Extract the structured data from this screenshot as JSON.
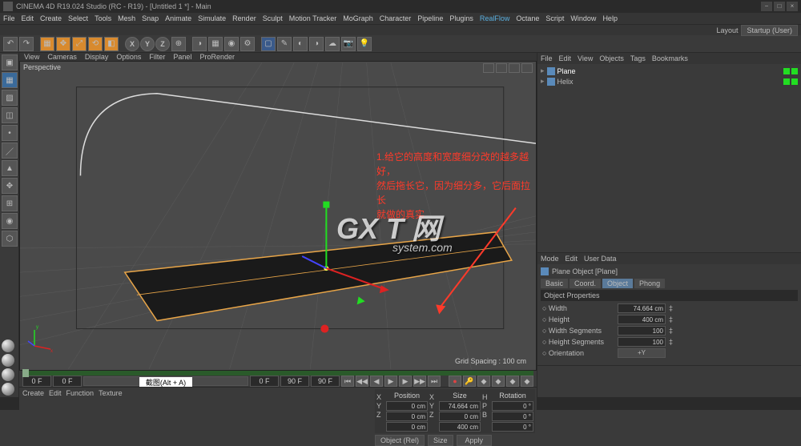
{
  "titlebar": {
    "title": "CINEMA 4D R19.024 Studio (RC - R19) - [Untitled 1 *] - Main"
  },
  "menubar": {
    "items": [
      "File",
      "Edit",
      "Create",
      "Select",
      "Tools",
      "Mesh",
      "Snap",
      "Animate",
      "Simulate",
      "Render",
      "Sculpt",
      "Motion Tracker",
      "MoGraph",
      "Character",
      "Pipeline",
      "Plugins",
      "RealFlow",
      "Octane",
      "Script",
      "Window",
      "Help"
    ]
  },
  "layout": {
    "label": "Layout",
    "value": "Startup (User)"
  },
  "toolbar_xyz": [
    "X",
    "Y",
    "Z"
  ],
  "viewport_menu": {
    "items": [
      "View",
      "Cameras",
      "Display",
      "Options",
      "Filter",
      "Panel",
      "ProRender"
    ]
  },
  "viewport": {
    "label": "Perspective",
    "grid_spacing": "Grid Spacing : 100 cm"
  },
  "annotation": {
    "line1": "1.给它的高度和宽度细分改的越多越好，",
    "line2": "然后拖长它，因为细分多，它后面拉长",
    "line3": "就做的真实"
  },
  "watermark": {
    "main": "GX T 网",
    "sub": "system.com"
  },
  "timeline": {
    "frame_start_a": "0 F",
    "frame_start_b": "0 F",
    "hint": "截图(Alt + A)",
    "frame_cur": "0 F",
    "frame_end_a": "90 F",
    "frame_end_b": "90 F"
  },
  "coord_panel": {
    "tabs": [
      "Create",
      "Edit",
      "Function",
      "Texture"
    ],
    "headers": [
      "Position",
      "Size",
      "Rotation"
    ],
    "rows": [
      {
        "axis": "X",
        "pos": "0 cm",
        "slbl": "X",
        "size": "74.664 cm",
        "rlbl": "H",
        "rot": "0 °"
      },
      {
        "axis": "Y",
        "pos": "0 cm",
        "slbl": "Y",
        "size": "0 cm",
        "rlbl": "P",
        "rot": "0 °"
      },
      {
        "axis": "Z",
        "pos": "0 cm",
        "slbl": "Z",
        "size": "400 cm",
        "rlbl": "B",
        "rot": "0 °"
      }
    ],
    "mode_drop": "Object (Rel)",
    "size_drop": "Size",
    "apply": "Apply"
  },
  "right_panel": {
    "menu": [
      "File",
      "Edit",
      "View",
      "Objects",
      "Tags",
      "Bookmarks"
    ],
    "tree": [
      {
        "name": "Plane",
        "selected": true
      },
      {
        "name": "Helix",
        "selected": false
      }
    ],
    "mode_menu": [
      "Mode",
      "Edit",
      "User Data"
    ],
    "object_title": "Plane Object [Plane]",
    "tabs": [
      "Basic",
      "Coord.",
      "Object",
      "Phong"
    ],
    "active_tab": "Object",
    "section": "Object Properties",
    "props": [
      {
        "label": "Width",
        "value": "74.664 cm"
      },
      {
        "label": "Height",
        "value": "400 cm"
      },
      {
        "label": "Width Segments",
        "value": "100"
      },
      {
        "label": "Height Segments",
        "value": "100"
      },
      {
        "label": "Orientation",
        "value": "+Y"
      }
    ]
  }
}
